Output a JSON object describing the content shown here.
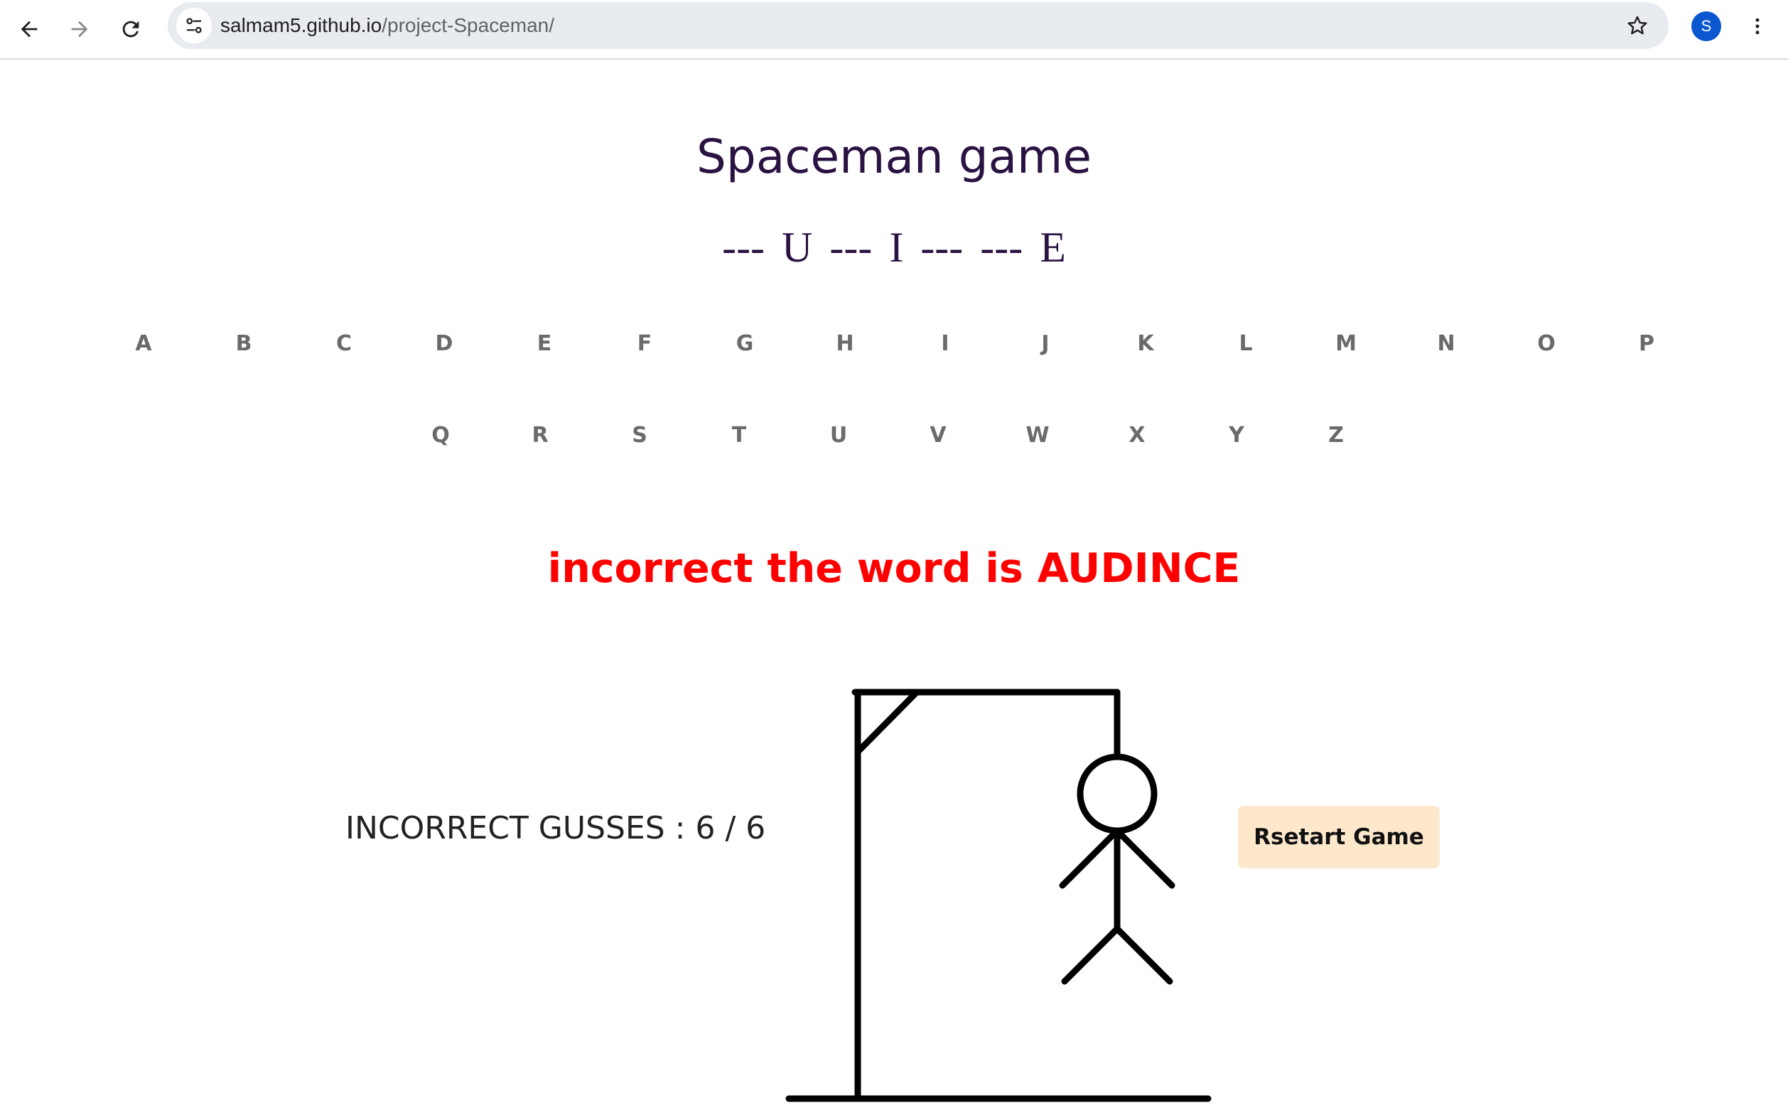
{
  "browser": {
    "url_host": "salmam5.github.io",
    "url_path": "/project-Spaceman/",
    "profile_initial": "S",
    "icons": [
      "back-arrow-icon",
      "forward-arrow-icon",
      "reload-icon",
      "site-settings-icon",
      "bookmark-star-icon",
      "kebab-menu-icon"
    ]
  },
  "game": {
    "title": "Spaceman game",
    "word_slots": [
      "---",
      "U",
      "---",
      "I",
      "---",
      "---",
      "E"
    ],
    "letters_row1": [
      "A",
      "B",
      "C",
      "D",
      "E",
      "F",
      "G",
      "H",
      "I",
      "J",
      "K",
      "L",
      "M",
      "N",
      "O",
      "P"
    ],
    "letters_row2": [
      "Q",
      "R",
      "S",
      "T",
      "U",
      "V",
      "W",
      "X",
      "Y",
      "Z"
    ],
    "result_message": "incorrect the word is AUDINCE",
    "guesses_label": "INCORRECT GUSSES : 6 / 6",
    "incorrect_guesses": 6,
    "max_guesses": 6,
    "restart_label": "Rsetart Game"
  },
  "colors": {
    "title": "#2a1242",
    "result": "#ff0000",
    "letter": "#6a6a6a",
    "restart_bg": "#fde8cc"
  }
}
